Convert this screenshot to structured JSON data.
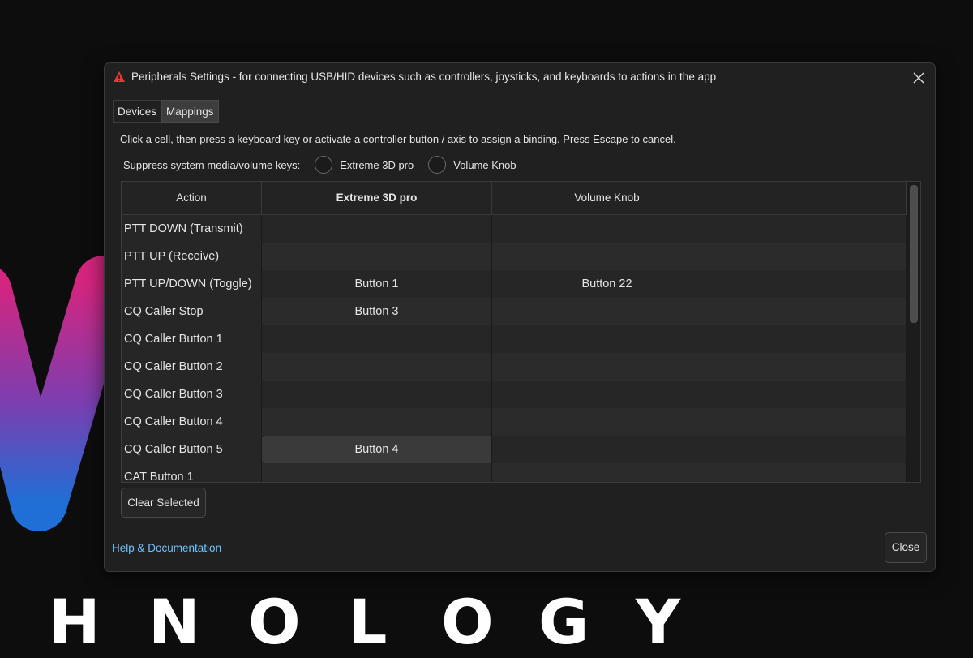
{
  "background": {
    "word_letters": [
      "H",
      "N",
      "O",
      "L",
      "O",
      "G",
      "Y"
    ],
    "logo_gradient": [
      "#d4257f",
      "#7a3fb0",
      "#1f6fd6"
    ]
  },
  "dialog": {
    "title": "Peripherals Settings - for connecting USB/HID devices such as controllers, joysticks, and keyboards to actions in the app",
    "app_icon": "warning-triangle-icon",
    "close_icon": "close-icon",
    "tabs": [
      {
        "label": "Devices",
        "active": false
      },
      {
        "label": "Mappings",
        "active": true
      }
    ],
    "instructions": "Click a cell, then press a keyboard key or activate a controller button / axis to assign a binding. Press Escape to cancel.",
    "suppress": {
      "label": "Suppress system media/volume keys:",
      "options": [
        {
          "label": "Extreme 3D pro",
          "checked": false
        },
        {
          "label": "Volume Knob",
          "checked": false
        }
      ]
    },
    "table": {
      "headers": [
        "Action",
        "Extreme 3D pro",
        "Volume Knob",
        ""
      ],
      "rows": [
        {
          "action": "PTT DOWN (Transmit)",
          "c1": "",
          "c2": "",
          "c3": ""
        },
        {
          "action": "PTT UP (Receive)",
          "c1": "",
          "c2": "",
          "c3": ""
        },
        {
          "action": "PTT UP/DOWN (Toggle)",
          "c1": "Button 1",
          "c2": "Button 22",
          "c3": ""
        },
        {
          "action": "CQ Caller Stop",
          "c1": "Button 3",
          "c2": "",
          "c3": ""
        },
        {
          "action": "CQ Caller Button 1",
          "c1": "",
          "c2": "",
          "c3": ""
        },
        {
          "action": "CQ Caller Button 2",
          "c1": "",
          "c2": "",
          "c3": ""
        },
        {
          "action": "CQ Caller Button 3",
          "c1": "",
          "c2": "",
          "c3": ""
        },
        {
          "action": "CQ Caller Button 4",
          "c1": "",
          "c2": "",
          "c3": ""
        },
        {
          "action": "CQ Caller Button 5",
          "c1": "Button 4",
          "c2": "",
          "c3": ""
        },
        {
          "action": "CAT Button 1",
          "c1": "",
          "c2": "",
          "c3": ""
        }
      ],
      "selected_cell": {
        "row": 8,
        "col": 1
      }
    },
    "clear_button": "Clear Selected",
    "help_link": "Help & Documentation",
    "close_button": "Close",
    "colors": {
      "link": "#6cc3ff",
      "icon_red": "#e53935"
    }
  }
}
